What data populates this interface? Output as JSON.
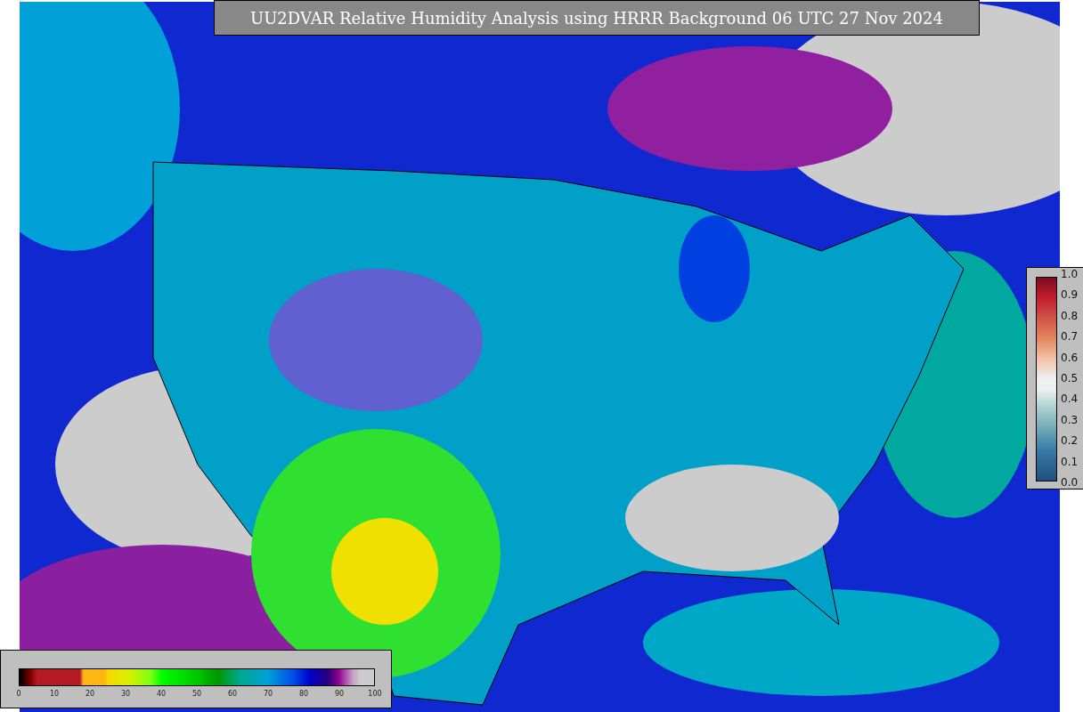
{
  "title": "UU2DVAR Relative Humidity Analysis using HRRR Background 06 UTC 27 Nov 2024",
  "humidity_colorbar": {
    "ticks": [
      "0",
      "10",
      "20",
      "30",
      "40",
      "50",
      "60",
      "70",
      "80",
      "90",
      "100"
    ]
  },
  "station_colorbar": {
    "ticks": [
      "1.0",
      "0.9",
      "0.8",
      "0.7",
      "0.6",
      "0.5",
      "0.4",
      "0.3",
      "0.2",
      "0.1",
      "0.0"
    ]
  }
}
